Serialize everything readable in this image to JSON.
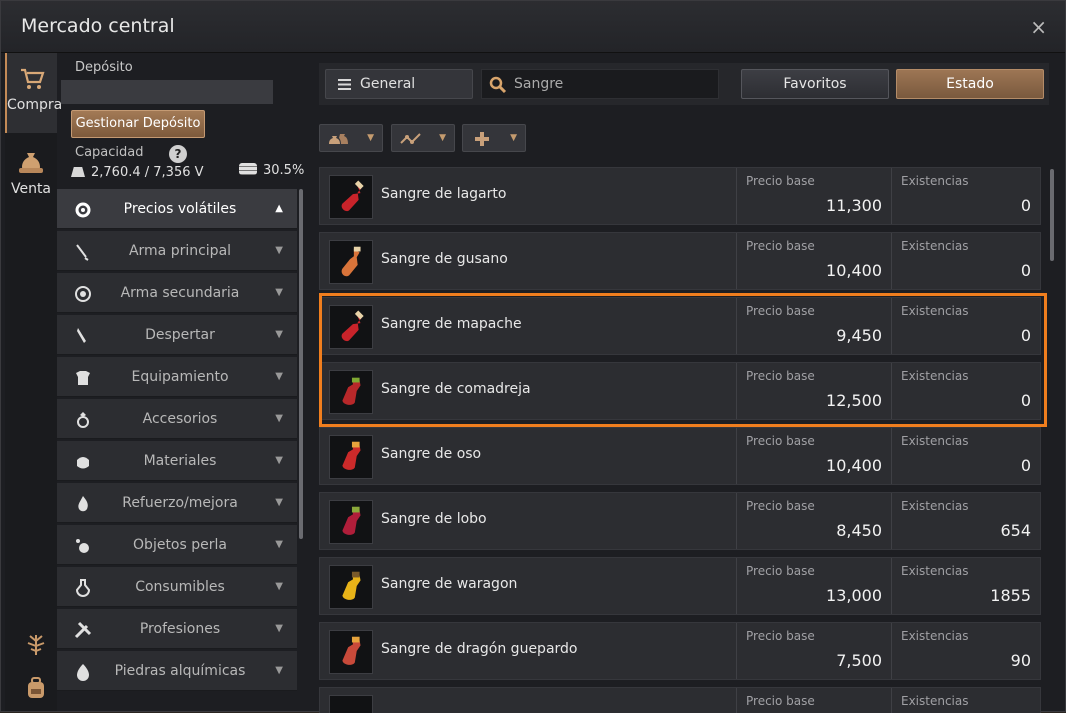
{
  "window": {
    "title": "Mercado central",
    "close_label": "×"
  },
  "tabs": [
    {
      "label": "Compra",
      "icon": "cart-icon",
      "active": true
    },
    {
      "label": "Venta",
      "icon": "money-bag-icon",
      "active": false
    }
  ],
  "deposit": {
    "label": "Depósito",
    "manage_button": "Gestionar Depósito",
    "capacity_label": "Capacidad",
    "help_label": "?",
    "capacity_value": "2,760.4 / 7,356 V",
    "capacity_percent": "30.5%"
  },
  "categories": [
    {
      "label": "Precios volátiles",
      "icon": "gear-icon",
      "active": true
    },
    {
      "label": "Arma principal",
      "icon": "sword-icon"
    },
    {
      "label": "Arma secundaria",
      "icon": "shield-icon"
    },
    {
      "label": "Despertar",
      "icon": "blade-icon"
    },
    {
      "label": "Equipamiento",
      "icon": "armor-icon"
    },
    {
      "label": "Accesorios",
      "icon": "ring-icon"
    },
    {
      "label": "Materiales",
      "icon": "ore-icon"
    },
    {
      "label": "Refuerzo/mejora",
      "icon": "flame-icon"
    },
    {
      "label": "Objetos perla",
      "icon": "pearl-icon"
    },
    {
      "label": "Consumibles",
      "icon": "potion-icon"
    },
    {
      "label": "Profesiones",
      "icon": "tools-icon"
    },
    {
      "label": "Piedras alquímicas",
      "icon": "stone-icon"
    }
  ],
  "toolbar": {
    "category_dropdown": "General",
    "search_value": "Sangre",
    "favorites_button": "Favoritos",
    "status_button": "Estado"
  },
  "items": [
    {
      "name": "Sangre de lagarto",
      "price_label": "Precio base",
      "price": "11,300",
      "stock_label": "Existencias",
      "stock": "0",
      "color": "#c8232a"
    },
    {
      "name": "Sangre de gusano",
      "price_label": "Precio base",
      "price": "10,400",
      "stock_label": "Existencias",
      "stock": "0",
      "color": "#d9743a"
    },
    {
      "name": "Sangre de mapache",
      "price_label": "Precio base",
      "price": "9,450",
      "stock_label": "Existencias",
      "stock": "0",
      "color": "#c8232a"
    },
    {
      "name": "Sangre de comadreja",
      "price_label": "Precio base",
      "price": "12,500",
      "stock_label": "Existencias",
      "stock": "0",
      "color": "#b8282a"
    },
    {
      "name": "Sangre de oso",
      "price_label": "Precio base",
      "price": "10,400",
      "stock_label": "Existencias",
      "stock": "0",
      "color": "#cc2a2a"
    },
    {
      "name": "Sangre de lobo",
      "price_label": "Precio base",
      "price": "8,450",
      "stock_label": "Existencias",
      "stock": "654",
      "color": "#b01e3a"
    },
    {
      "name": "Sangre de waragon",
      "price_label": "Precio base",
      "price": "13,000",
      "stock_label": "Existencias",
      "stock": "1855",
      "color": "#e8b318"
    },
    {
      "name": "Sangre de dragón guepardo",
      "price_label": "Precio base",
      "price": "7,500",
      "stock_label": "Existencias",
      "stock": "90",
      "color": "#c84a3a"
    },
    {
      "name": "",
      "price_label": "Precio base",
      "price": "",
      "stock_label": "Existencias",
      "stock": "",
      "color": "#888888"
    }
  ],
  "colors": {
    "accent": "#c48b57",
    "highlight": "#f07e1e"
  }
}
